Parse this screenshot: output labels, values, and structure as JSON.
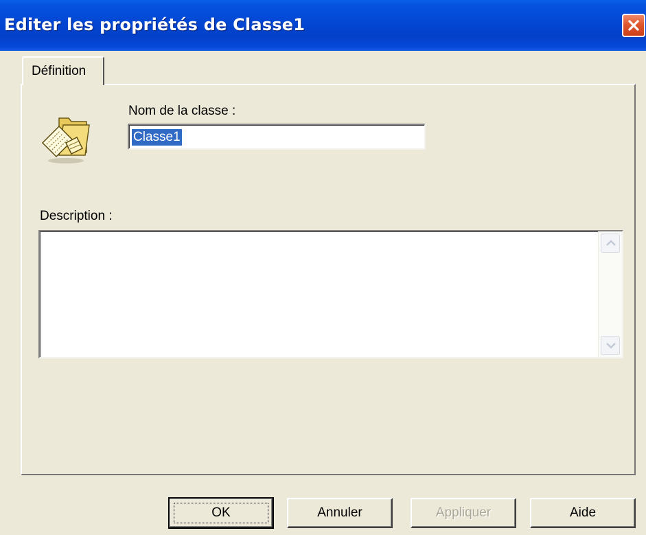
{
  "window": {
    "title": "Editer les propriétés de Classe1",
    "close_icon": "close-icon"
  },
  "tabs": [
    {
      "label": "Définition",
      "active": true
    }
  ],
  "form": {
    "class_icon": "class-folder-icon",
    "name_label": "Nom de la classe :",
    "name_value": "Classe1",
    "description_label": "Description :",
    "description_value": ""
  },
  "buttons": {
    "ok": "OK",
    "cancel": "Annuler",
    "apply": "Appliquer",
    "help": "Aide"
  },
  "colors": {
    "titlebar": "#0347d3",
    "dialog_bg": "#ece9d8",
    "selection": "#316ac5",
    "close_button": "#e0582e"
  }
}
